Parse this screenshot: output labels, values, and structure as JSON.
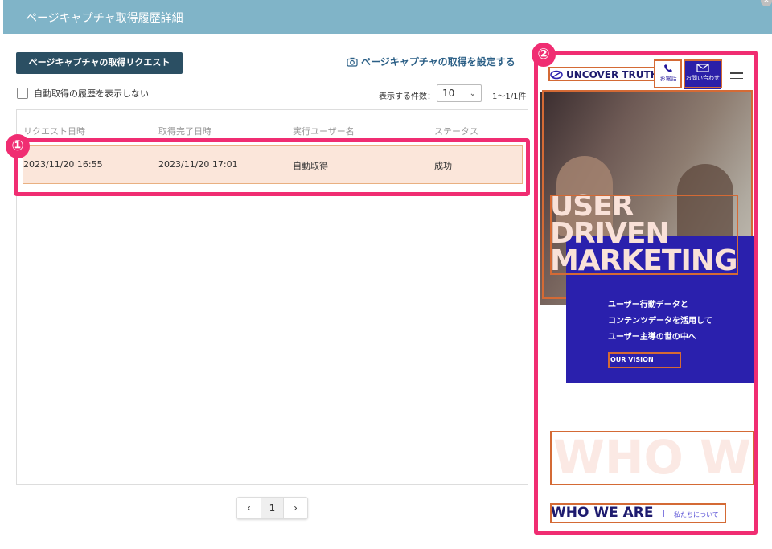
{
  "dialog": {
    "title": "ページキャプチャ取得履歴詳細",
    "close_icon": "close-icon"
  },
  "toolbar": {
    "request_button": "ページキャプチャの取得リクエスト",
    "settings_link": "ページキャプチャの取得を設定する",
    "settings_icon": "camera-icon"
  },
  "filter": {
    "hide_auto_label": "自動取得の履歴を表示しない",
    "hide_auto_checked": false
  },
  "paging": {
    "per_page_label": "表示する件数：",
    "per_page_value": "10",
    "range_label": "1〜1/1件",
    "prev": "‹",
    "current_page": "1",
    "next": "›"
  },
  "table": {
    "columns": [
      "リクエスト日時",
      "取得完了日時",
      "実行ユーザー名",
      "ステータス"
    ],
    "rows": [
      {
        "requested": "2023/11/20 16:55",
        "completed": "2023/11/20 17:01",
        "user": "自動取得",
        "status": "成功"
      }
    ]
  },
  "annotations": {
    "badge_1": "①",
    "badge_2": "②",
    "highlight_color": "#f02d72"
  },
  "preview": {
    "logo": "UNCOVER TRUTH",
    "tel_label": "お電話",
    "mail_label": "お問い合わせ",
    "hero_lines": [
      "USER",
      "DRIVEN",
      "MARKETING"
    ],
    "hero_sub_lines": [
      "ユーザー行動データと",
      "コンテンツデータを活用して",
      "ユーザー主導の世の中へ"
    ],
    "vision_button": "OUR VISION",
    "who_big": "WHO W",
    "who_title": "WHO WE ARE",
    "who_sep": "|",
    "who_link": "私たちについて"
  }
}
